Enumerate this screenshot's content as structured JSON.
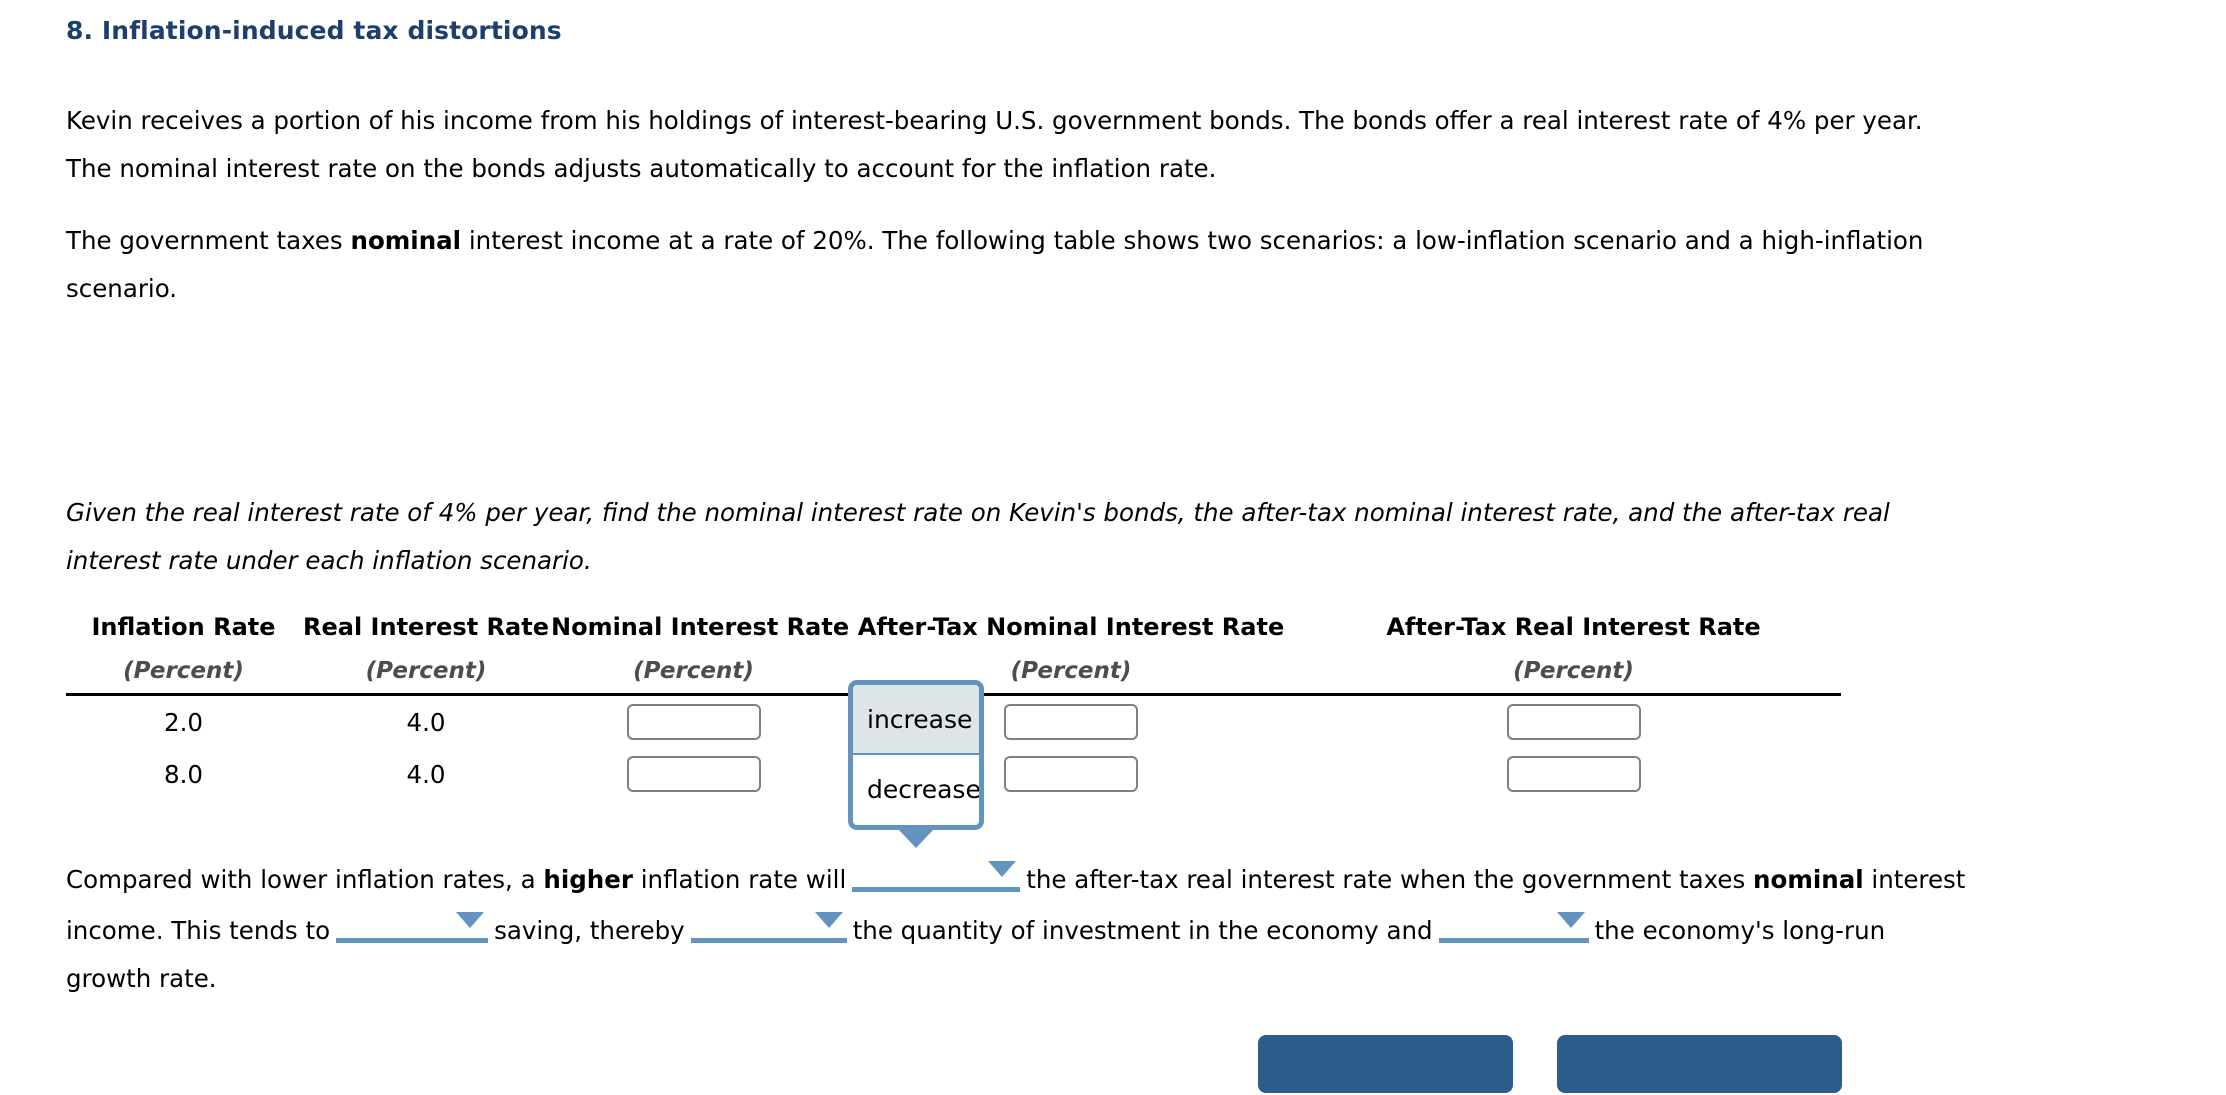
{
  "question": {
    "number_title": "8. Inflation-induced tax distortions",
    "paragraph_1_a": "Kevin receives a portion of his income from his holdings of interest-bearing U.S. government bonds. The bonds offer a real interest rate of 4% per year. The nominal interest rate on the bonds adjusts automatically to account for the inflation rate.",
    "paragraph_2_a": "The government taxes ",
    "paragraph_2_bold": "nominal",
    "paragraph_2_b": " interest income at a rate of 20%. The following table shows two scenarios: a low-inflation scenario and a high-inflation scenario.",
    "prompt": "Given the real interest rate of 4% per year, find the nominal interest rate on Kevin's bonds, the after-tax nominal interest rate, and the after-tax real interest rate under each inflation scenario."
  },
  "table": {
    "headers": [
      "Inflation Rate",
      "Real Interest Rate",
      "Nominal Interest Rate",
      "After-Tax Nominal Interest Rate",
      "After-Tax Real Interest Rate"
    ],
    "units": [
      "(Percent)",
      "(Percent)",
      "(Percent)",
      "(Percent)",
      "(Percent)"
    ],
    "rows": [
      {
        "inflation_rate": "2.0",
        "real_interest_rate": "4.0",
        "nominal_interest_rate": "",
        "after_tax_nominal": "",
        "after_tax_real": ""
      },
      {
        "inflation_rate": "8.0",
        "real_interest_rate": "4.0",
        "nominal_interest_rate": "",
        "after_tax_nominal": "",
        "after_tax_real": ""
      }
    ],
    "input_placeholder": ""
  },
  "open_dropdown": {
    "options": [
      "increase",
      "decrease"
    ],
    "selected": "increase",
    "border_color": "#6593c0",
    "highlight_color": "#dde5e9"
  },
  "conclusion": {
    "seg_1": "Compared with lower inflation rates, a ",
    "bold_1": "higher",
    "seg_2": " inflation rate will",
    "seg_3": "the after-tax real interest rate when the government taxes",
    "bold_2": "nominal",
    "seg_4": " interest income. This tends to",
    "seg_5": "saving, thereby",
    "seg_6": "the quantity of investment in the economy and",
    "seg_7": "the economy's long-run growth rate.",
    "select_1_value": "",
    "select_2_value": "",
    "select_3_value": "",
    "select_4_value": "",
    "caret_icon": "chevron-down-icon"
  },
  "buttons": {
    "grade_label": "",
    "save_label": "",
    "color": "#2b5c8a"
  },
  "colors": {
    "title": "#1d3f6e",
    "accent_blue": "#6593c0",
    "button_blue": "#2b5c8a",
    "unit_gray": "#4d4d4d",
    "input_border": "#808080"
  }
}
